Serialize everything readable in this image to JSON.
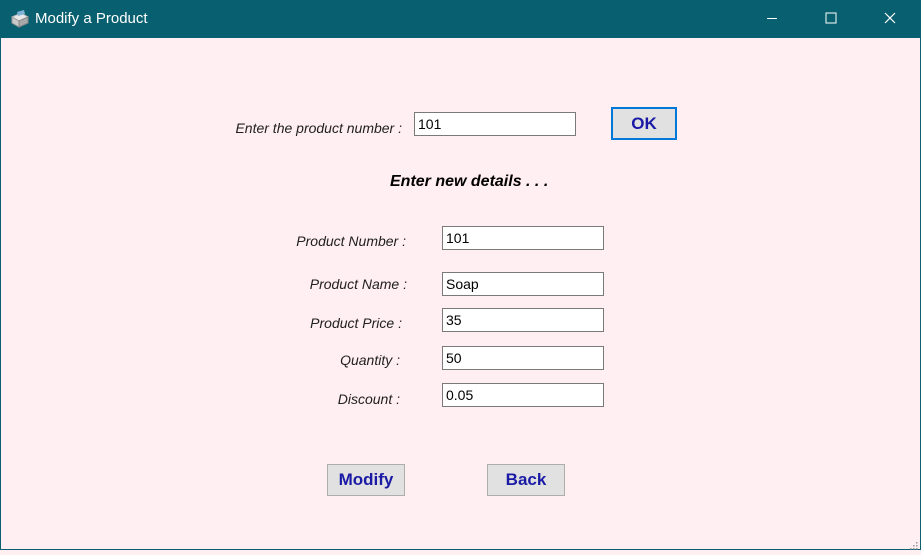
{
  "window": {
    "title": "Modify a Product",
    "app_icon": "product-box-icon",
    "minimize_icon": "minimize-icon",
    "maximize_icon": "maximize-icon",
    "close_icon": "close-icon"
  },
  "lookup": {
    "label": "Enter the product number :",
    "value": "101",
    "ok_label": "OK"
  },
  "heading": "Enter new details . . .",
  "fields": {
    "product_number": {
      "label": "Product Number :",
      "value": "101"
    },
    "product_name": {
      "label": "Product Name :",
      "value": "Soap"
    },
    "product_price": {
      "label": "Product Price :",
      "value": "35"
    },
    "quantity": {
      "label": "Quantity :",
      "value": "50"
    },
    "discount": {
      "label": "Discount :",
      "value": "0.05"
    }
  },
  "buttons": {
    "modify_label": "Modify",
    "back_label": "Back"
  },
  "colors": {
    "titlebar": "#075f6f",
    "background": "#ffeef2",
    "button_text": "#1a1aa6",
    "focus_border": "#0078d7"
  }
}
